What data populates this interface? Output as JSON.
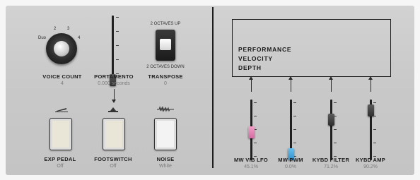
{
  "voice_count": {
    "label": "VOICE COUNT",
    "value": "4",
    "ticks": [
      "Duo",
      "2",
      "3",
      "4"
    ]
  },
  "portamento": {
    "label": "PORTAMENTO",
    "value": "0.000 seconds",
    "level": 0
  },
  "transpose": {
    "label": "TRANSPOSE",
    "value": "0",
    "up_label": "2 OCTAVES UP",
    "down_label": "2 OCTAVES DOWN"
  },
  "pedals": [
    {
      "label": "EXP PEDAL",
      "value": "Off",
      "icon": "expression-pedal-icon"
    },
    {
      "label": "FOOTSWITCH",
      "value": "Off",
      "icon": "footswitch-icon"
    },
    {
      "label": "NOISE",
      "value": "White",
      "icon": "noise-waveform-icon"
    }
  ],
  "display": {
    "lines": [
      "PERFORMANCE",
      "VELOCITY",
      "DEPTH"
    ]
  },
  "depth_sliders": [
    {
      "label": "MW VIB LFO",
      "value": "45.1%",
      "level": 0.451,
      "color": "#e27fb5"
    },
    {
      "label": "MW PWM",
      "value": "0.0%",
      "level": 0.0,
      "color": "#4aa9e0"
    },
    {
      "label": "KYBD FILTER",
      "value": "71.2%",
      "level": 0.712,
      "color": "#3a3a3a"
    },
    {
      "label": "KYBD AMP",
      "value": "90.2%",
      "level": 0.902,
      "color": "#3a3a3a"
    }
  ]
}
